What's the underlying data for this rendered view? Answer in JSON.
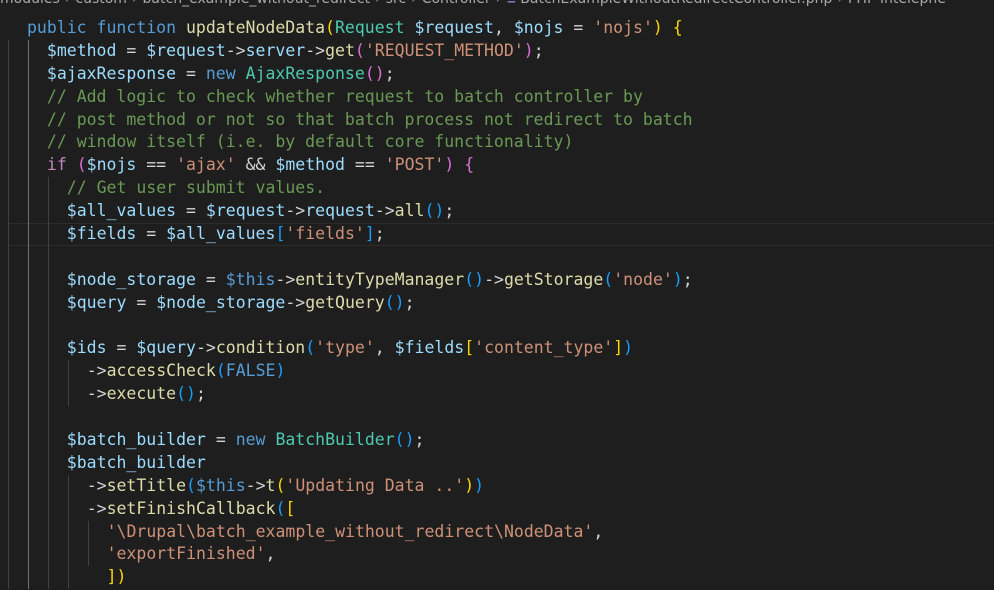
{
  "breadcrumb": [
    "modules",
    "custom",
    "batch_example_without_redirect",
    "src",
    "Controller",
    "BatchExampleWithoutRedirectController.php",
    "PHP Intelephe"
  ],
  "code_lines": [
    {
      "indent": 0,
      "guides": [],
      "tokens": [
        [
          "t-kw",
          "public "
        ],
        [
          "t-kw",
          "function "
        ],
        [
          "t-fn",
          "updateNodeData"
        ],
        [
          "t-b1",
          "("
        ],
        [
          "t-cls",
          "Request "
        ],
        [
          "t-var",
          "$request"
        ],
        [
          "t-punc",
          ", "
        ],
        [
          "t-var",
          "$nojs "
        ],
        [
          "t-punc",
          "= "
        ],
        [
          "t-str",
          "'nojs'"
        ],
        [
          "t-b1",
          ")"
        ],
        [
          "t-punc",
          " "
        ],
        [
          "t-b1",
          "{"
        ]
      ]
    },
    {
      "indent": 1,
      "guides": [
        1
      ],
      "tokens": [
        [
          "t-var",
          "$method "
        ],
        [
          "t-punc",
          "= "
        ],
        [
          "t-var",
          "$request"
        ],
        [
          "t-punc",
          "->"
        ],
        [
          "t-var",
          "server"
        ],
        [
          "t-punc",
          "->"
        ],
        [
          "t-fn",
          "get"
        ],
        [
          "t-b2",
          "("
        ],
        [
          "t-str",
          "'REQUEST_METHOD'"
        ],
        [
          "t-b2",
          ")"
        ],
        [
          "t-punc",
          ";"
        ]
      ]
    },
    {
      "indent": 1,
      "guides": [
        1
      ],
      "tokens": [
        [
          "t-var",
          "$ajaxResponse "
        ],
        [
          "t-punc",
          "= "
        ],
        [
          "t-kw",
          "new "
        ],
        [
          "t-cls",
          "AjaxResponse"
        ],
        [
          "t-b2",
          "()"
        ],
        [
          "t-punc",
          ";"
        ]
      ]
    },
    {
      "indent": 1,
      "guides": [
        1
      ],
      "tokens": [
        [
          "t-cmt",
          "// Add logic to check whether request to batch controller by"
        ]
      ]
    },
    {
      "indent": 1,
      "guides": [
        1
      ],
      "tokens": [
        [
          "t-cmt",
          "// post method or not so that batch process not redirect to batch"
        ]
      ]
    },
    {
      "indent": 1,
      "guides": [
        1
      ],
      "tokens": [
        [
          "t-cmt",
          "// window itself (i.e. by default core functionality)"
        ]
      ]
    },
    {
      "indent": 1,
      "guides": [
        1
      ],
      "tokens": [
        [
          "t-ctl",
          "if "
        ],
        [
          "t-b2",
          "("
        ],
        [
          "t-var",
          "$nojs "
        ],
        [
          "t-punc",
          "== "
        ],
        [
          "t-str",
          "'ajax' "
        ],
        [
          "t-punc",
          "&& "
        ],
        [
          "t-var",
          "$method "
        ],
        [
          "t-punc",
          "== "
        ],
        [
          "t-str",
          "'POST'"
        ],
        [
          "t-b2",
          ")"
        ],
        [
          "t-punc",
          " "
        ],
        [
          "t-b2",
          "{"
        ]
      ]
    },
    {
      "indent": 2,
      "guides": [
        1,
        2
      ],
      "tokens": [
        [
          "t-cmt",
          "// Get user submit values."
        ]
      ]
    },
    {
      "indent": 2,
      "guides": [
        1,
        2
      ],
      "tokens": [
        [
          "t-var",
          "$all_values "
        ],
        [
          "t-punc",
          "= "
        ],
        [
          "t-var",
          "$request"
        ],
        [
          "t-punc",
          "->"
        ],
        [
          "t-var",
          "request"
        ],
        [
          "t-punc",
          "->"
        ],
        [
          "t-fn",
          "all"
        ],
        [
          "t-b3",
          "()"
        ],
        [
          "t-punc",
          ";"
        ]
      ]
    },
    {
      "indent": 2,
      "guides": [
        1,
        2
      ],
      "active": true,
      "tokens": [
        [
          "t-var",
          "$fields "
        ],
        [
          "t-punc",
          "= "
        ],
        [
          "t-var",
          "$all_values"
        ],
        [
          "t-b3",
          "["
        ],
        [
          "t-str",
          "'fields'"
        ],
        [
          "t-b3",
          "]"
        ],
        [
          "t-punc",
          ";"
        ]
      ]
    },
    {
      "indent": 2,
      "guides": [
        1,
        2
      ],
      "tokens": []
    },
    {
      "indent": 2,
      "guides": [
        1,
        2
      ],
      "tokens": [
        [
          "t-var",
          "$node_storage "
        ],
        [
          "t-punc",
          "= "
        ],
        [
          "t-this",
          "$this"
        ],
        [
          "t-punc",
          "->"
        ],
        [
          "t-fn",
          "entityTypeManager"
        ],
        [
          "t-b3",
          "()"
        ],
        [
          "t-punc",
          "->"
        ],
        [
          "t-fn",
          "getStorage"
        ],
        [
          "t-b3",
          "("
        ],
        [
          "t-str",
          "'node'"
        ],
        [
          "t-b3",
          ")"
        ],
        [
          "t-punc",
          ";"
        ]
      ]
    },
    {
      "indent": 2,
      "guides": [
        1,
        2
      ],
      "tokens": [
        [
          "t-var",
          "$query "
        ],
        [
          "t-punc",
          "= "
        ],
        [
          "t-var",
          "$node_storage"
        ],
        [
          "t-punc",
          "->"
        ],
        [
          "t-fn",
          "getQuery"
        ],
        [
          "t-b3",
          "()"
        ],
        [
          "t-punc",
          ";"
        ]
      ]
    },
    {
      "indent": 2,
      "guides": [
        1,
        2
      ],
      "tokens": []
    },
    {
      "indent": 2,
      "guides": [
        1,
        2
      ],
      "tokens": [
        [
          "t-var",
          "$ids "
        ],
        [
          "t-punc",
          "= "
        ],
        [
          "t-var",
          "$query"
        ],
        [
          "t-punc",
          "->"
        ],
        [
          "t-fn",
          "condition"
        ],
        [
          "t-b3",
          "("
        ],
        [
          "t-str",
          "'type'"
        ],
        [
          "t-punc",
          ", "
        ],
        [
          "t-var",
          "$fields"
        ],
        [
          "t-b1",
          "["
        ],
        [
          "t-str",
          "'content_type'"
        ],
        [
          "t-b1",
          "]"
        ],
        [
          "t-b3",
          ")"
        ]
      ]
    },
    {
      "indent": 3,
      "guides": [
        1,
        2,
        3
      ],
      "tokens": [
        [
          "t-punc",
          "->"
        ],
        [
          "t-fn",
          "accessCheck"
        ],
        [
          "t-b3",
          "("
        ],
        [
          "t-kw",
          "FALSE"
        ],
        [
          "t-b3",
          ")"
        ]
      ]
    },
    {
      "indent": 3,
      "guides": [
        1,
        2,
        3
      ],
      "tokens": [
        [
          "t-punc",
          "->"
        ],
        [
          "t-fn",
          "execute"
        ],
        [
          "t-b3",
          "()"
        ],
        [
          "t-punc",
          ";"
        ]
      ]
    },
    {
      "indent": 2,
      "guides": [
        1,
        2
      ],
      "tokens": []
    },
    {
      "indent": 2,
      "guides": [
        1,
        2
      ],
      "tokens": [
        [
          "t-var",
          "$batch_builder "
        ],
        [
          "t-punc",
          "= "
        ],
        [
          "t-kw",
          "new "
        ],
        [
          "t-cls",
          "BatchBuilder"
        ],
        [
          "t-b3",
          "()"
        ],
        [
          "t-punc",
          ";"
        ]
      ]
    },
    {
      "indent": 2,
      "guides": [
        1,
        2
      ],
      "tokens": [
        [
          "t-var",
          "$batch_builder"
        ]
      ]
    },
    {
      "indent": 3,
      "guides": [
        1,
        2,
        3
      ],
      "tokens": [
        [
          "t-punc",
          "->"
        ],
        [
          "t-fn",
          "setTitle"
        ],
        [
          "t-b3",
          "("
        ],
        [
          "t-this",
          "$this"
        ],
        [
          "t-punc",
          "->"
        ],
        [
          "t-fn",
          "t"
        ],
        [
          "t-b1",
          "("
        ],
        [
          "t-str",
          "'Updating Data ..'"
        ],
        [
          "t-b1",
          ")"
        ],
        [
          "t-b3",
          ")"
        ]
      ]
    },
    {
      "indent": 3,
      "guides": [
        1,
        2,
        3
      ],
      "tokens": [
        [
          "t-punc",
          "->"
        ],
        [
          "t-fn",
          "setFinishCallback"
        ],
        [
          "t-b3",
          "("
        ],
        [
          "t-b1",
          "["
        ]
      ]
    },
    {
      "indent": 4,
      "guides": [
        1,
        2,
        3,
        4
      ],
      "tokens": [
        [
          "t-str",
          "'\\Drupal\\batch_example_without_redirect\\NodeData'"
        ],
        [
          "t-punc",
          ","
        ]
      ]
    },
    {
      "indent": 4,
      "guides": [
        1,
        2,
        3,
        4
      ],
      "tokens": [
        [
          "t-str",
          "'exportFinished'"
        ],
        [
          "t-punc",
          ","
        ]
      ]
    },
    {
      "indent": 4,
      "guides": [
        1,
        2,
        3
      ],
      "tokens": [
        [
          "t-b1",
          "])"
        ]
      ]
    }
  ]
}
